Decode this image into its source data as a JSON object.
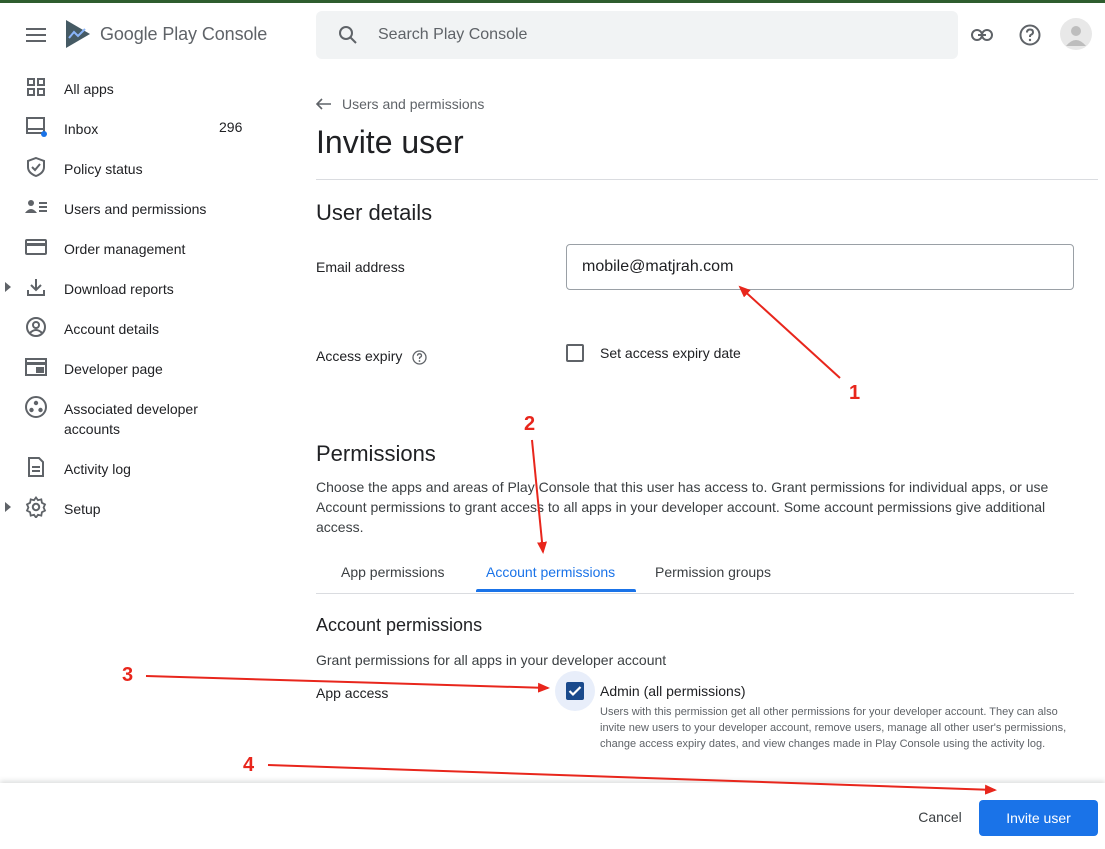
{
  "app": {
    "logo_text": "Google Play Console"
  },
  "search": {
    "placeholder": "Search Play Console"
  },
  "sidebar": {
    "items": [
      {
        "label": "All apps",
        "icon": "grid-icon"
      },
      {
        "label": "Inbox",
        "icon": "inbox-icon",
        "count": "296"
      },
      {
        "label": "Policy status",
        "icon": "shield-icon"
      },
      {
        "label": "Users and permissions",
        "icon": "users-icon"
      },
      {
        "label": "Order management",
        "icon": "credit-card-icon"
      },
      {
        "label": "Download reports",
        "icon": "download-icon",
        "expandable": true
      },
      {
        "label": "Account details",
        "icon": "account-circle-icon"
      },
      {
        "label": "Developer page",
        "icon": "web-page-icon"
      },
      {
        "label": "Associated developer accounts",
        "icon": "linked-accounts-icon"
      },
      {
        "label": "Activity log",
        "icon": "document-icon"
      },
      {
        "label": "Setup",
        "icon": "gear-icon",
        "expandable": true
      }
    ]
  },
  "breadcrumb": {
    "back_label": "Users and permissions"
  },
  "page": {
    "title": "Invite user"
  },
  "user_details": {
    "heading": "User details",
    "email_label": "Email address",
    "email_value": "mobile@matjrah.com",
    "expiry_label": "Access expiry",
    "expiry_checkbox_label": "Set access expiry date",
    "expiry_checked": false
  },
  "permissions": {
    "heading": "Permissions",
    "description": "Choose the apps and areas of Play Console that this user has access to. Grant permissions for individual apps, or use Account permissions to grant access to all apps in your developer account. Some account permissions give additional access.",
    "tabs": [
      "App permissions",
      "Account permissions",
      "Permission groups"
    ],
    "active_tab": "Account permissions"
  },
  "account_permissions": {
    "heading": "Account permissions",
    "subheading": "Grant permissions for all apps in your developer account",
    "app_access_label": "App access",
    "admin_label": "Admin (all permissions)",
    "admin_checked": true,
    "admin_description": "Users with this permission get all other permissions for your developer account. They can also invite new users to your developer account, remove users, manage all other user's permissions, change access expiry dates, and view changes made in Play Console using the activity log."
  },
  "footer": {
    "cancel_label": "Cancel",
    "invite_label": "Invite user"
  },
  "annotations": [
    "1",
    "2",
    "3",
    "4"
  ],
  "colors": {
    "accent": "#1a73e8",
    "annotation": "#e8261c",
    "checkbox_checked": "#1a4a8c"
  }
}
